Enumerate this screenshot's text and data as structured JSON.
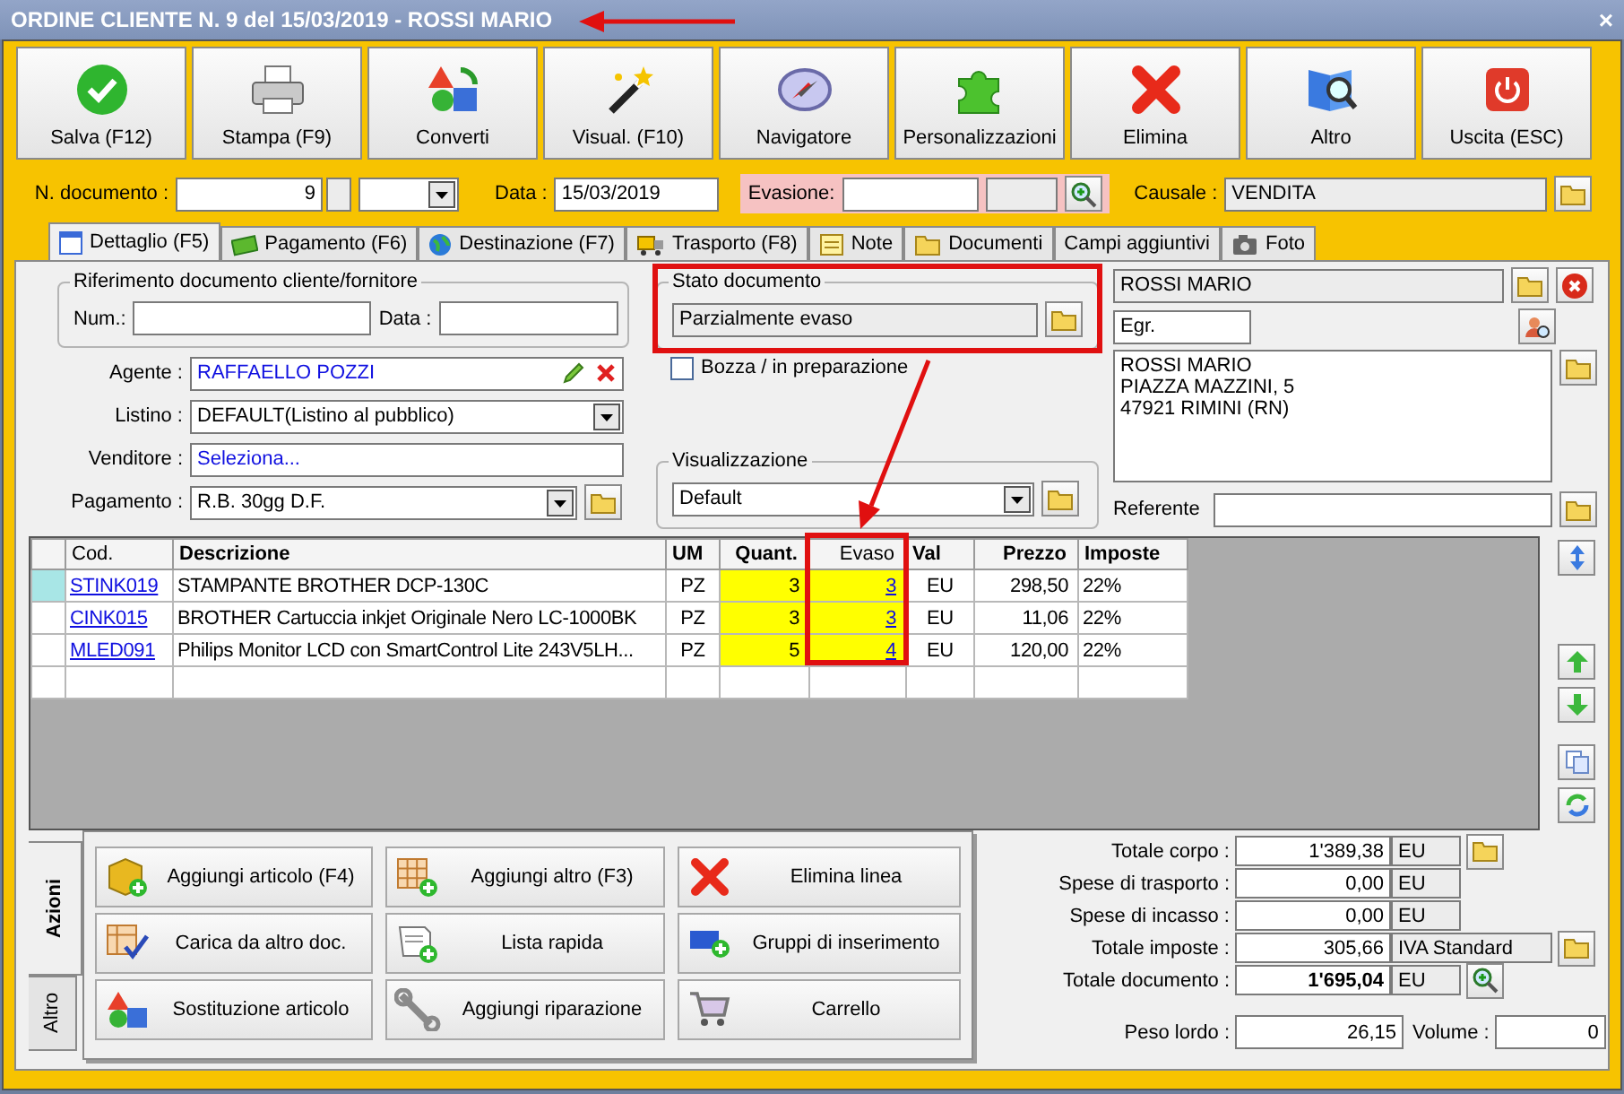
{
  "window": {
    "title": "ORDINE CLIENTE N. 9 del 15/03/2019 - ROSSI MARIO",
    "close": "×"
  },
  "toolbar": [
    {
      "label": "Salva (F12)"
    },
    {
      "label": "Stampa (F9)"
    },
    {
      "label": "Converti"
    },
    {
      "label": "Visual. (F10)"
    },
    {
      "label": "Navigatore"
    },
    {
      "label": "Personalizzazioni"
    },
    {
      "label": "Elimina"
    },
    {
      "label": "Altro"
    },
    {
      "label": "Uscita (ESC)"
    }
  ],
  "header": {
    "numero_label": "N. documento :",
    "numero": "9",
    "data_label": "Data :",
    "data": "15/03/2019",
    "evasione_label": "Evasione:",
    "causale_label": "Causale :",
    "causale": "VENDITA"
  },
  "tabs": [
    {
      "label": "Dettaglio (F5)",
      "selected": true
    },
    {
      "label": "Pagamento (F6)",
      "selected": false
    },
    {
      "label": "Destinazione (F7)",
      "selected": false
    },
    {
      "label": "Trasporto (F8)",
      "selected": false
    },
    {
      "label": "Note",
      "selected": false
    },
    {
      "label": "Documenti",
      "selected": false
    },
    {
      "label": "Campi aggiuntivi",
      "selected": false
    },
    {
      "label": "Foto",
      "selected": false
    }
  ],
  "riferimento": {
    "title": "Riferimento documento cliente/fornitore",
    "num_label": "Num.:",
    "data_label": "Data :"
  },
  "form_rows": [
    {
      "label": "Agente :",
      "value": "RAFFAELLO POZZI",
      "kind": "agent"
    },
    {
      "label": "Listino :",
      "value": "DEFAULT(Listino al pubblico)",
      "kind": "dropdown"
    },
    {
      "label": "Venditore :",
      "value": "Seleziona...",
      "kind": "link"
    },
    {
      "label": "Pagamento :",
      "value": "R.B. 30gg D.F.",
      "kind": "dropdown_folder"
    }
  ],
  "stato": {
    "title": "Stato documento",
    "value": "Parzialmente evaso",
    "draft_label": "Bozza / in preparazione",
    "draft_checked": false
  },
  "visualizzazione": {
    "title": "Visualizzazione",
    "value": "Default"
  },
  "cliente": {
    "name": "ROSSI MARIO",
    "salutation": "Egr.",
    "address": [
      "ROSSI MARIO",
      "PIAZZA MAZZINI, 5",
      "47921 RIMINI (RN)"
    ],
    "referente_label": "Referente"
  },
  "table": {
    "columns": [
      {
        "label": "Cod.",
        "kind": "link",
        "bold": false
      },
      {
        "label": "Descrizione",
        "kind": "text",
        "bold": true
      },
      {
        "label": "UM",
        "kind": "center",
        "bold": true
      },
      {
        "label": "Quant.",
        "kind": "qty",
        "bold": true
      },
      {
        "label": "Evaso",
        "kind": "qty_link",
        "bold": false
      },
      {
        "label": "Val",
        "kind": "center",
        "bold": true
      },
      {
        "label": "Prezzo",
        "kind": "right",
        "bold": true
      },
      {
        "label": "Imposte",
        "kind": "text",
        "bold": true
      }
    ],
    "rows": [
      {
        "selected": true,
        "cells": [
          "STINK019",
          "STAMPANTE BROTHER DCP-130C",
          "PZ",
          "3",
          "3",
          "EU",
          "298,50",
          "22%"
        ]
      },
      {
        "selected": false,
        "cells": [
          "CINK015",
          "BROTHER Cartuccia inkjet Originale Nero LC-1000BK",
          "PZ",
          "3",
          "3",
          "EU",
          "11,06",
          "22%"
        ]
      },
      {
        "selected": false,
        "cells": [
          "MLED091",
          "Philips Monitor LCD con SmartControl Lite 243V5LH...",
          "PZ",
          "5",
          "4",
          "EU",
          "120,00",
          "22%"
        ]
      }
    ]
  },
  "actions": {
    "tabs": [
      {
        "label": "Azioni",
        "selected": true
      },
      {
        "label": "Altro",
        "selected": false
      }
    ],
    "buttons": [
      "Aggiungi articolo (F4)",
      "Aggiungi altro (F3)",
      "Elimina linea",
      "Carica da altro doc.",
      "Lista rapida",
      "Gruppi di inserimento",
      "Sostituzione articolo",
      "Aggiungi riparazione",
      "Carrello"
    ]
  },
  "totals": [
    {
      "label": "Totale corpo :",
      "value": "1'389,38",
      "unit": "EU",
      "bold": false,
      "kind": "folder"
    },
    {
      "label": "Spese di trasporto :",
      "value": "0,00",
      "unit": "EU",
      "bold": false,
      "kind": "plain"
    },
    {
      "label": "Spese di incasso :",
      "value": "0,00",
      "unit": "EU",
      "bold": false,
      "kind": "plain"
    },
    {
      "label": "Totale imposte :",
      "value": "305,66",
      "unit": "IVA Standard",
      "bold": false,
      "kind": "wide_folder"
    },
    {
      "label": "Totale documento :",
      "value": "1'695,04",
      "unit": "EU",
      "bold": true,
      "kind": "zoom"
    }
  ],
  "peso": {
    "label": "Peso lordo :",
    "value": "26,15"
  },
  "volume": {
    "label": "Volume :",
    "value": "0"
  }
}
